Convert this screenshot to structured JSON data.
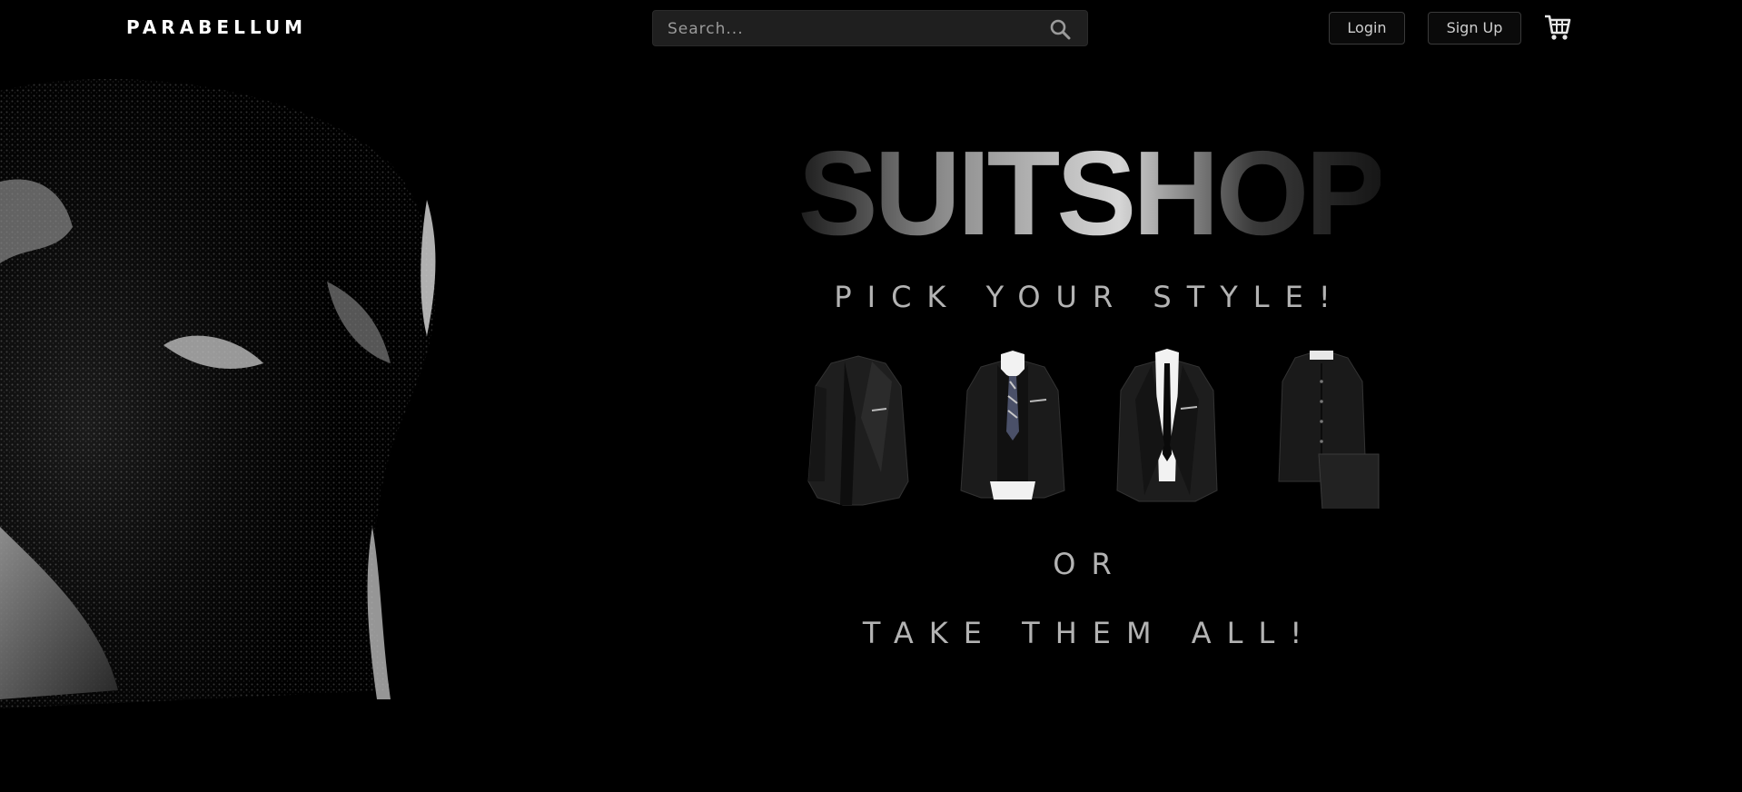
{
  "header": {
    "brand": "PARABELLUM",
    "search": {
      "placeholder": "Search...",
      "value": "",
      "icon": "search-icon"
    },
    "login_label": "Login",
    "signup_label": "Sign Up",
    "cart_icon": "shopping-cart-icon"
  },
  "hero": {
    "title": "SUITSHOP",
    "tagline": "PICK YOUR STYLE!",
    "suits": [
      {
        "icon": "blazer-icon"
      },
      {
        "icon": "three-piece-suit-icon"
      },
      {
        "icon": "tuxedo-icon"
      },
      {
        "icon": "mandarin-collar-suit-icon"
      }
    ],
    "or_label": "OR",
    "cta_label": "TAKE THEM ALL!"
  },
  "colors": {
    "background": "#000000",
    "text": "#ffffff",
    "muted_text": "#b3b3b3",
    "search_bg": "#1f1f1f",
    "button_border": "#3a3a3a"
  }
}
